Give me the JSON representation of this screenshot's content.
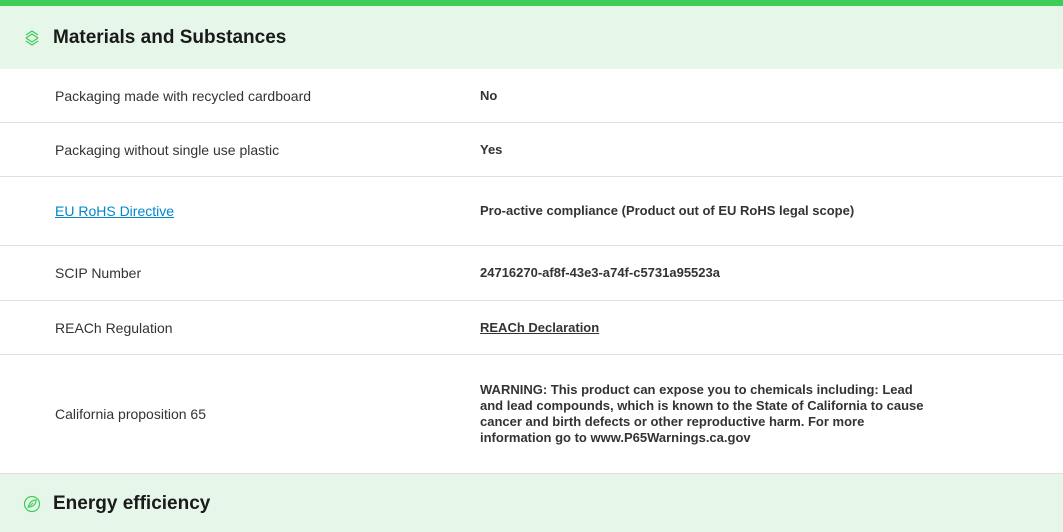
{
  "sections": {
    "materials": {
      "title": "Materials and Substances",
      "icon": "layers-icon"
    },
    "energy": {
      "title": "Energy efficiency",
      "icon": "leaf-circle-icon"
    }
  },
  "rows": [
    {
      "label": "Packaging made with recycled cardboard",
      "value": "No"
    },
    {
      "label": "Packaging without single use plastic",
      "value": "Yes"
    },
    {
      "label": "EU RoHS Directive",
      "value": "Pro-active compliance (Product out of EU RoHS legal scope)"
    },
    {
      "label": "SCIP Number",
      "value": "24716270-af8f-43e3-a74f-c5731a95523a"
    },
    {
      "label": "REACh Regulation",
      "value": "REACh Declaration"
    },
    {
      "label": "California proposition 65",
      "value": "WARNING: This product can expose you to chemicals including: Lead and lead compounds, which is known to the State of California to cause cancer and birth defects or other reproductive harm. For more information go to www.P65Warnings.ca.gov"
    }
  ],
  "colors": {
    "accent": "#3dcd58",
    "header_bg": "#e6f6e9",
    "link": "#0087cd"
  }
}
